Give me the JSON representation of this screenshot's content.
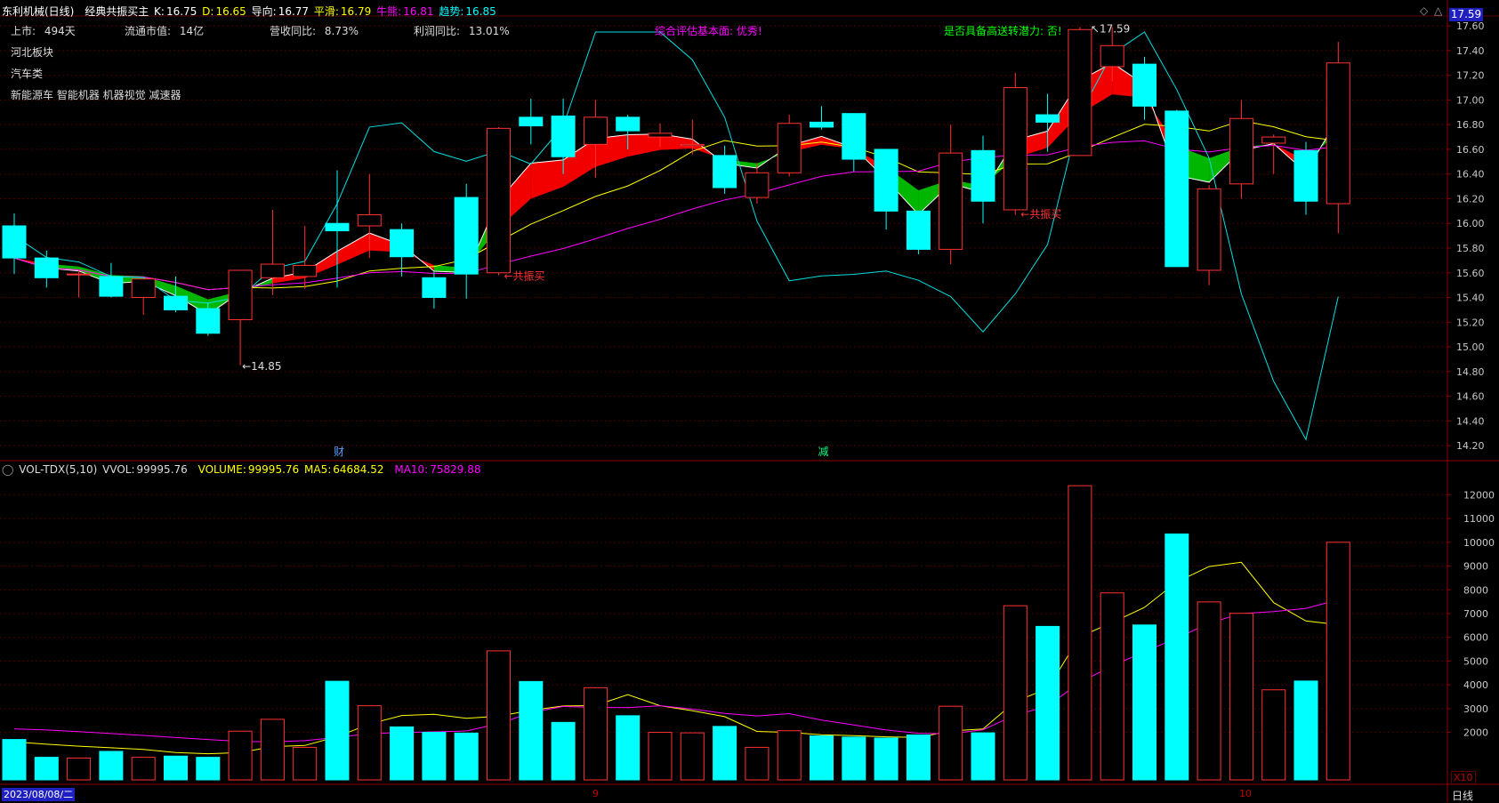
{
  "header": {
    "stock_name": "东利机械(日线)",
    "indicator_name": "经典共振买主",
    "k_label": "K:",
    "k_value": "16.75",
    "d_label": "D:",
    "d_value": "16.65",
    "dao_label": "导向:",
    "dao_value": "16.77",
    "ping_label": "平滑:",
    "ping_value": "16.79",
    "niu_label": "牛熊:",
    "niu_value": "16.81",
    "trend_label": "趋势:",
    "trend_value": "16.85"
  },
  "info": {
    "listed_label": "上市:",
    "listed_value": "494天",
    "cap_label": "流通市值:",
    "cap_value": "14亿",
    "rev_label": "营收同比:",
    "rev_value": "8.73%",
    "profit_label": "利润同比:",
    "profit_value": "13.01%",
    "eval_text": "综合评估基本面: 优秀!",
    "potential_text": "是否具备高送转潜力: 否!",
    "sector1": "河北板块",
    "sector2": "汽车类",
    "concepts": "新能源车 智能机器 机器视觉 减速器"
  },
  "price_badge": "17.59",
  "annotations": {
    "low": "←14.85",
    "high": "17.59",
    "signal": "共振买",
    "event_cai": "财",
    "event_jian": "减"
  },
  "price_axis": [
    "17.60",
    "17.40",
    "17.20",
    "17.00",
    "16.80",
    "16.60",
    "16.40",
    "16.20",
    "16.00",
    "15.80",
    "15.60",
    "15.40",
    "15.20",
    "15.00",
    "14.80",
    "14.60",
    "14.40",
    "14.20"
  ],
  "volume_header": {
    "name": "VOL-TDX(5,10)",
    "vvol_label": "VVOL:",
    "vvol_value": "99995.76",
    "volume_label": "VOLUME:",
    "volume_value": "99995.76",
    "ma5_label": "MA5:",
    "ma5_value": "64684.52",
    "ma10_label": "MA10:",
    "ma10_value": "75829.88"
  },
  "volume_axis": [
    "12000",
    "11000",
    "10000",
    "9000",
    "8000",
    "7000",
    "6000",
    "5000",
    "4000",
    "3000",
    "2000"
  ],
  "volume_unit": "X10",
  "date_axis": {
    "start": "2023/08/08/二",
    "sep_sep": "9",
    "sep_oct": "10"
  },
  "period_label": "日线",
  "colors": {
    "up": "#ff3232",
    "down": "#00ffff",
    "ma5": "#ffff00",
    "ma10": "#ff00ff",
    "band_up": "#ff0000",
    "band_down": "#00c000"
  },
  "chart_data": {
    "type": "candlestick",
    "candles": [
      {
        "o": 15.98,
        "h": 16.08,
        "l": 15.59,
        "c": 15.72
      },
      {
        "o": 15.72,
        "h": 15.78,
        "l": 15.48,
        "c": 15.56
      },
      {
        "o": 15.59,
        "h": 15.62,
        "l": 15.4,
        "c": 15.59
      },
      {
        "o": 15.57,
        "h": 15.68,
        "l": 15.4,
        "c": 15.41
      },
      {
        "o": 15.4,
        "h": 15.55,
        "l": 15.26,
        "c": 15.55
      },
      {
        "o": 15.41,
        "h": 15.57,
        "l": 15.28,
        "c": 15.3
      },
      {
        "o": 15.31,
        "h": 15.36,
        "l": 15.09,
        "c": 15.11
      },
      {
        "o": 15.22,
        "h": 15.62,
        "l": 14.85,
        "c": 15.62
      },
      {
        "o": 15.56,
        "h": 16.11,
        "l": 15.42,
        "c": 15.67
      },
      {
        "o": 15.57,
        "h": 15.98,
        "l": 15.47,
        "c": 15.66
      },
      {
        "o": 16.0,
        "h": 16.43,
        "l": 15.48,
        "c": 15.94
      },
      {
        "o": 15.98,
        "h": 16.4,
        "l": 15.72,
        "c": 16.07
      },
      {
        "o": 15.95,
        "h": 16.0,
        "l": 15.57,
        "c": 15.73
      },
      {
        "o": 15.56,
        "h": 15.61,
        "l": 15.31,
        "c": 15.4
      },
      {
        "o": 16.21,
        "h": 16.32,
        "l": 15.39,
        "c": 15.59
      },
      {
        "o": 15.6,
        "h": 16.78,
        "l": 15.58,
        "c": 16.77
      },
      {
        "o": 16.86,
        "h": 17.01,
        "l": 16.64,
        "c": 16.79
      },
      {
        "o": 16.87,
        "h": 17.01,
        "l": 16.4,
        "c": 16.54
      },
      {
        "o": 16.64,
        "h": 17.0,
        "l": 16.37,
        "c": 16.86
      },
      {
        "o": 16.86,
        "h": 16.88,
        "l": 16.6,
        "c": 16.75
      },
      {
        "o": 16.7,
        "h": 16.81,
        "l": 16.62,
        "c": 16.73
      },
      {
        "o": 16.63,
        "h": 16.84,
        "l": 16.56,
        "c": 16.64
      },
      {
        "o": 16.55,
        "h": 16.63,
        "l": 16.24,
        "c": 16.29
      },
      {
        "o": 16.21,
        "h": 16.49,
        "l": 16.16,
        "c": 16.41
      },
      {
        "o": 16.41,
        "h": 16.88,
        "l": 16.38,
        "c": 16.81
      },
      {
        "o": 16.82,
        "h": 16.95,
        "l": 16.76,
        "c": 16.78
      },
      {
        "o": 16.89,
        "h": 16.89,
        "l": 16.42,
        "c": 16.52
      },
      {
        "o": 16.6,
        "h": 16.6,
        "l": 15.95,
        "c": 16.1
      },
      {
        "o": 16.1,
        "h": 16.1,
        "l": 15.75,
        "c": 15.79
      },
      {
        "o": 15.79,
        "h": 16.8,
        "l": 15.67,
        "c": 16.57
      },
      {
        "o": 16.59,
        "h": 16.71,
        "l": 16.0,
        "c": 16.18
      },
      {
        "o": 16.11,
        "h": 17.22,
        "l": 16.07,
        "c": 17.1
      },
      {
        "o": 16.88,
        "h": 17.05,
        "l": 16.58,
        "c": 16.82
      },
      {
        "o": 16.55,
        "h": 17.59,
        "l": 16.55,
        "c": 17.57
      },
      {
        "o": 17.27,
        "h": 17.59,
        "l": 17.15,
        "c": 17.44
      },
      {
        "o": 17.29,
        "h": 17.35,
        "l": 16.84,
        "c": 16.95
      },
      {
        "o": 16.91,
        "h": 16.92,
        "l": 15.65,
        "c": 15.65
      },
      {
        "o": 15.62,
        "h": 16.31,
        "l": 15.5,
        "c": 16.28
      },
      {
        "o": 16.32,
        "h": 17.0,
        "l": 16.2,
        "c": 16.85
      },
      {
        "o": 16.65,
        "h": 16.72,
        "l": 16.4,
        "c": 16.7
      },
      {
        "o": 16.59,
        "h": 16.66,
        "l": 16.07,
        "c": 16.18
      },
      {
        "o": 16.16,
        "h": 17.47,
        "l": 15.92,
        "c": 17.3
      }
    ],
    "volume": [
      1700,
      950,
      920,
      1200,
      950,
      1000,
      950,
      2050,
      2550,
      1370,
      4150,
      3120,
      2230,
      2000,
      1970,
      5430,
      4140,
      2420,
      3880,
      2700,
      2000,
      1980,
      2250,
      1370,
      2070,
      1850,
      1800,
      1760,
      1890,
      3100,
      1980,
      7330,
      6460,
      12380,
      7870,
      6520,
      10350,
      7490,
      7010,
      3790,
      4160,
      10000
    ],
    "ma5": [
      1600,
      1500,
      1420,
      1350,
      1280,
      1150,
      1100,
      1150,
      1400,
      1450,
      1820,
      2350,
      2710,
      2760,
      2590,
      2680,
      2930,
      3110,
      3130,
      3590,
      3120,
      2910,
      2660,
      2040,
      2000,
      1900,
      1860,
      1810,
      1790,
      2060,
      2140,
      3300,
      3840,
      6030,
      6620,
      7260,
      8330,
      8980,
      9160,
      7460,
      6690,
      6530
    ],
    "ma10": [
      2150,
      2100,
      2030,
      1950,
      1870,
      1780,
      1700,
      1620,
      1600,
      1650,
      1790,
      1950,
      1990,
      2020,
      2060,
      2360,
      2830,
      3090,
      3050,
      3040,
      3120,
      2980,
      2800,
      2690,
      2790,
      2520,
      2310,
      2100,
      1960,
      1940,
      2110,
      2730,
      3100,
      4110,
      4790,
      5400,
      5960,
      6600,
      7000,
      7080,
      7220,
      7580
    ],
    "price_ylim": [
      14.1,
      17.68
    ],
    "volume_ylim": [
      0,
      12800
    ]
  }
}
